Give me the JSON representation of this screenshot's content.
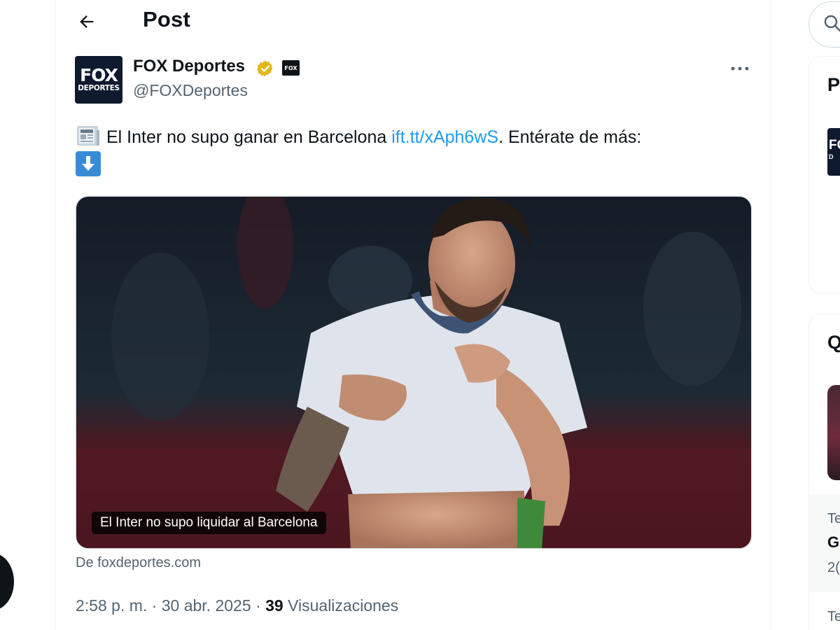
{
  "header": {
    "title": "Post"
  },
  "post": {
    "author_name": "FOX Deportes",
    "author_handle": "@FOXDeportes",
    "avatar_logo": "FOX",
    "avatar_logo_sub": "DEPORTES",
    "affiliate_logo": "FOX",
    "text_before_link": "El Inter no supo ganar en Barcelona ",
    "link_text": "ift.tt/xAph6wS",
    "text_after_link": ". Entérate de más:",
    "emoji_lead": "newspaper-icon",
    "emoji_trail": "down-arrow-icon",
    "media_caption": "El Inter no supo liquidar al Barcelona",
    "card_source": "De foxdeportes.com",
    "time": "2:58 p. m.",
    "date": "30 abr. 2025",
    "views_count": "39",
    "views_label": "Visualizaciones",
    "separator": "·"
  },
  "sidebar": {
    "panel1_letter": "P",
    "thumb_logo": "FOX",
    "thumb_logo_sub": "D",
    "panel2_letter": "Q",
    "trend1_meta": "Te",
    "trend1_title": "G",
    "trend1_sub": "2(",
    "trend2_meta": "Te"
  },
  "colors": {
    "accent_link": "#1d9bf0",
    "verified_gold": "#e2b719",
    "text_secondary": "#536471"
  }
}
